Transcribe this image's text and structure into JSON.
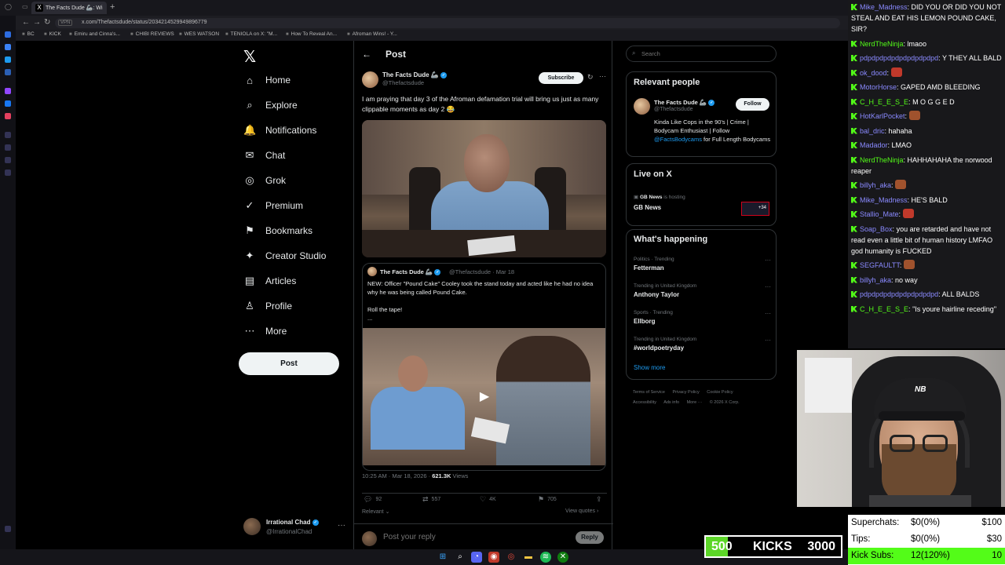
{
  "browser": {
    "tab_title": "The Facts Dude 🦾: Wi",
    "url": "x.com/Thefactsdude/status/2034214529949896779",
    "vpn_label": "VPN",
    "bookmarks": [
      "BC",
      "KICK",
      "Emiru and Cinna's...",
      "CHIBI REVIEWS",
      "WES WATSON",
      "TENIOLA on X: \"M...",
      "How To Reveal An...",
      "Afroman Wins! - Y..."
    ]
  },
  "x": {
    "nav": [
      {
        "icon": "⌂",
        "label": "Home"
      },
      {
        "icon": "⌕",
        "label": "Explore"
      },
      {
        "icon": "🔔",
        "label": "Notifications"
      },
      {
        "icon": "✉",
        "label": "Chat"
      },
      {
        "icon": "◎",
        "label": "Grok"
      },
      {
        "icon": "✓",
        "label": "Premium"
      },
      {
        "icon": "⚑",
        "label": "Bookmarks"
      },
      {
        "icon": "✦",
        "label": "Creator Studio"
      },
      {
        "icon": "▤",
        "label": "Articles"
      },
      {
        "icon": "♙",
        "label": "Profile"
      },
      {
        "icon": "⋯",
        "label": "More"
      }
    ],
    "post_button": "Post",
    "account": {
      "name": "Irrational Chad",
      "handle": "@IrrationalChad"
    },
    "page_title": "Post",
    "tweet": {
      "author": "The Facts Dude 🦾",
      "handle": "@Thefactsdude",
      "subscribe": "Subscribe",
      "text": "I am praying that day 3 of the Afroman defamation trial will bring us just as many clippable moments as day 2 😂",
      "time": "10:25 AM · Mar 18, 2026 · ",
      "views_count": "621.3K",
      "views_label": " Views",
      "stats": {
        "replies": "92",
        "reposts": "557",
        "likes": "4K",
        "bookmarks": "705"
      },
      "relevant": "Relevant ⌄",
      "view_quotes": "View quotes ›",
      "reply_placeholder": "Post your reply",
      "reply_button": "Reply"
    },
    "quote": {
      "author": "The Facts Dude 🦾",
      "meta": "@Thefactsdude · Mar 18",
      "text": "NEW: Officer \"Pound Cake\" Cooley took the stand today and acted like he had no idea why he was being called Pound Cake.",
      "text2": "Roll the tape!",
      "text3": "..."
    },
    "search_placeholder": "Search",
    "relevant_people": {
      "title": "Relevant people",
      "name": "The Facts Dude 🦾",
      "handle": "@Thefactsdude",
      "follow": "Follow",
      "bio": "Kinda Like Cops in the 90's | Crime | Bodycam Enthusiast | Follow ",
      "bio_link": "@FactsBodycams",
      "bio_end": " for Full Length Bodycams"
    },
    "live": {
      "title": "Live on X",
      "host": "GB News",
      "host_suffix": " is hosting",
      "name": "GB News",
      "badge": "+34"
    },
    "happening": {
      "title": "What's happening",
      "trends": [
        {
          "cat": "Politics · Trending",
          "name": "Fetterman"
        },
        {
          "cat": "Trending in United Kingdom",
          "name": "Anthony Taylor"
        },
        {
          "cat": "Sports · Trending",
          "name": "Ellborg"
        },
        {
          "cat": "Trending in United Kingdom",
          "name": "#worldpoetryday"
        }
      ],
      "show_more": "Show more"
    },
    "footer": [
      "Terms of Service",
      "Privacy Policy",
      "Cookie Policy",
      "Accessibility",
      "Ads info",
      "More ···",
      "© 2026 X Corp."
    ]
  },
  "chat": [
    {
      "user": "Mike_Madness",
      "color": "#8a8aff",
      "text": "DID YOU OR DID YOU NOT STEAL AND EAT HIS LEMON POUND CAKE, SIR?"
    },
    {
      "user": "NerdTheNinja",
      "color": "#53fc18",
      "text": "lmaoo"
    },
    {
      "user": "pdpdpdpdpdpdpdpdpdpd",
      "color": "#8a8aff",
      "text": "Y THEY ALL BALD"
    },
    {
      "user": "ok_dood",
      "color": "#8a8aff",
      "text": "",
      "emote": "#c0392b"
    },
    {
      "user": "MotorHorse",
      "color": "#8a8aff",
      "text": "GAPED AMD BLEEDING"
    },
    {
      "user": "C_H_E_E_S_E",
      "color": "#53fc18",
      "text": "M O G G E D"
    },
    {
      "user": "HotKarlPocket",
      "color": "#8a8aff",
      "text": "",
      "emote": "#a0522d"
    },
    {
      "user": "bal_dric",
      "color": "#8a8aff",
      "text": "hahaha"
    },
    {
      "user": "Madador",
      "color": "#8a8aff",
      "text": "LMAO"
    },
    {
      "user": "NerdTheNinja",
      "color": "#53fc18",
      "text": "HAHHAHAHA the norwood reaper"
    },
    {
      "user": "billyh_aka",
      "color": "#8a8aff",
      "text": "",
      "emote": "#a0522d"
    },
    {
      "user": "Mike_Madness",
      "color": "#8a8aff",
      "text": "HE'S BALD"
    },
    {
      "user": "Stallio_Mate",
      "color": "#8a8aff",
      "text": "",
      "emote": "#c0392b"
    },
    {
      "user": "Soap_Box",
      "color": "#8a8aff",
      "text": "you are retarded and have not read even a little bit of human history LMFAO god humanity is FUCKED"
    },
    {
      "user": "SEGFAULTT",
      "color": "#8a8aff",
      "text": "",
      "emote": "#a0522d"
    },
    {
      "user": "billyh_aka",
      "color": "#8a8aff",
      "text": "no way"
    },
    {
      "user": "pdpdpdpdpdpdpdpdpdpd",
      "color": "#8a8aff",
      "text": "ALL BALDS"
    },
    {
      "user": "C_H_E_E_S_E",
      "color": "#53fc18",
      "text": "\"Is youre hairline receding\""
    }
  ],
  "goals": {
    "superchats": {
      "label": "Superchats:",
      "current": "$0(0%)",
      "target": "$100"
    },
    "tips": {
      "label": "Tips:",
      "current": "$0(0%)",
      "target": "$30"
    },
    "subs": {
      "label": "Kick Subs:",
      "current": "12(120%)",
      "target": "10",
      "progress": 1.2
    },
    "kicks": {
      "min": "500",
      "label": "KICKS",
      "max": "3000",
      "progress": 0.0
    }
  }
}
